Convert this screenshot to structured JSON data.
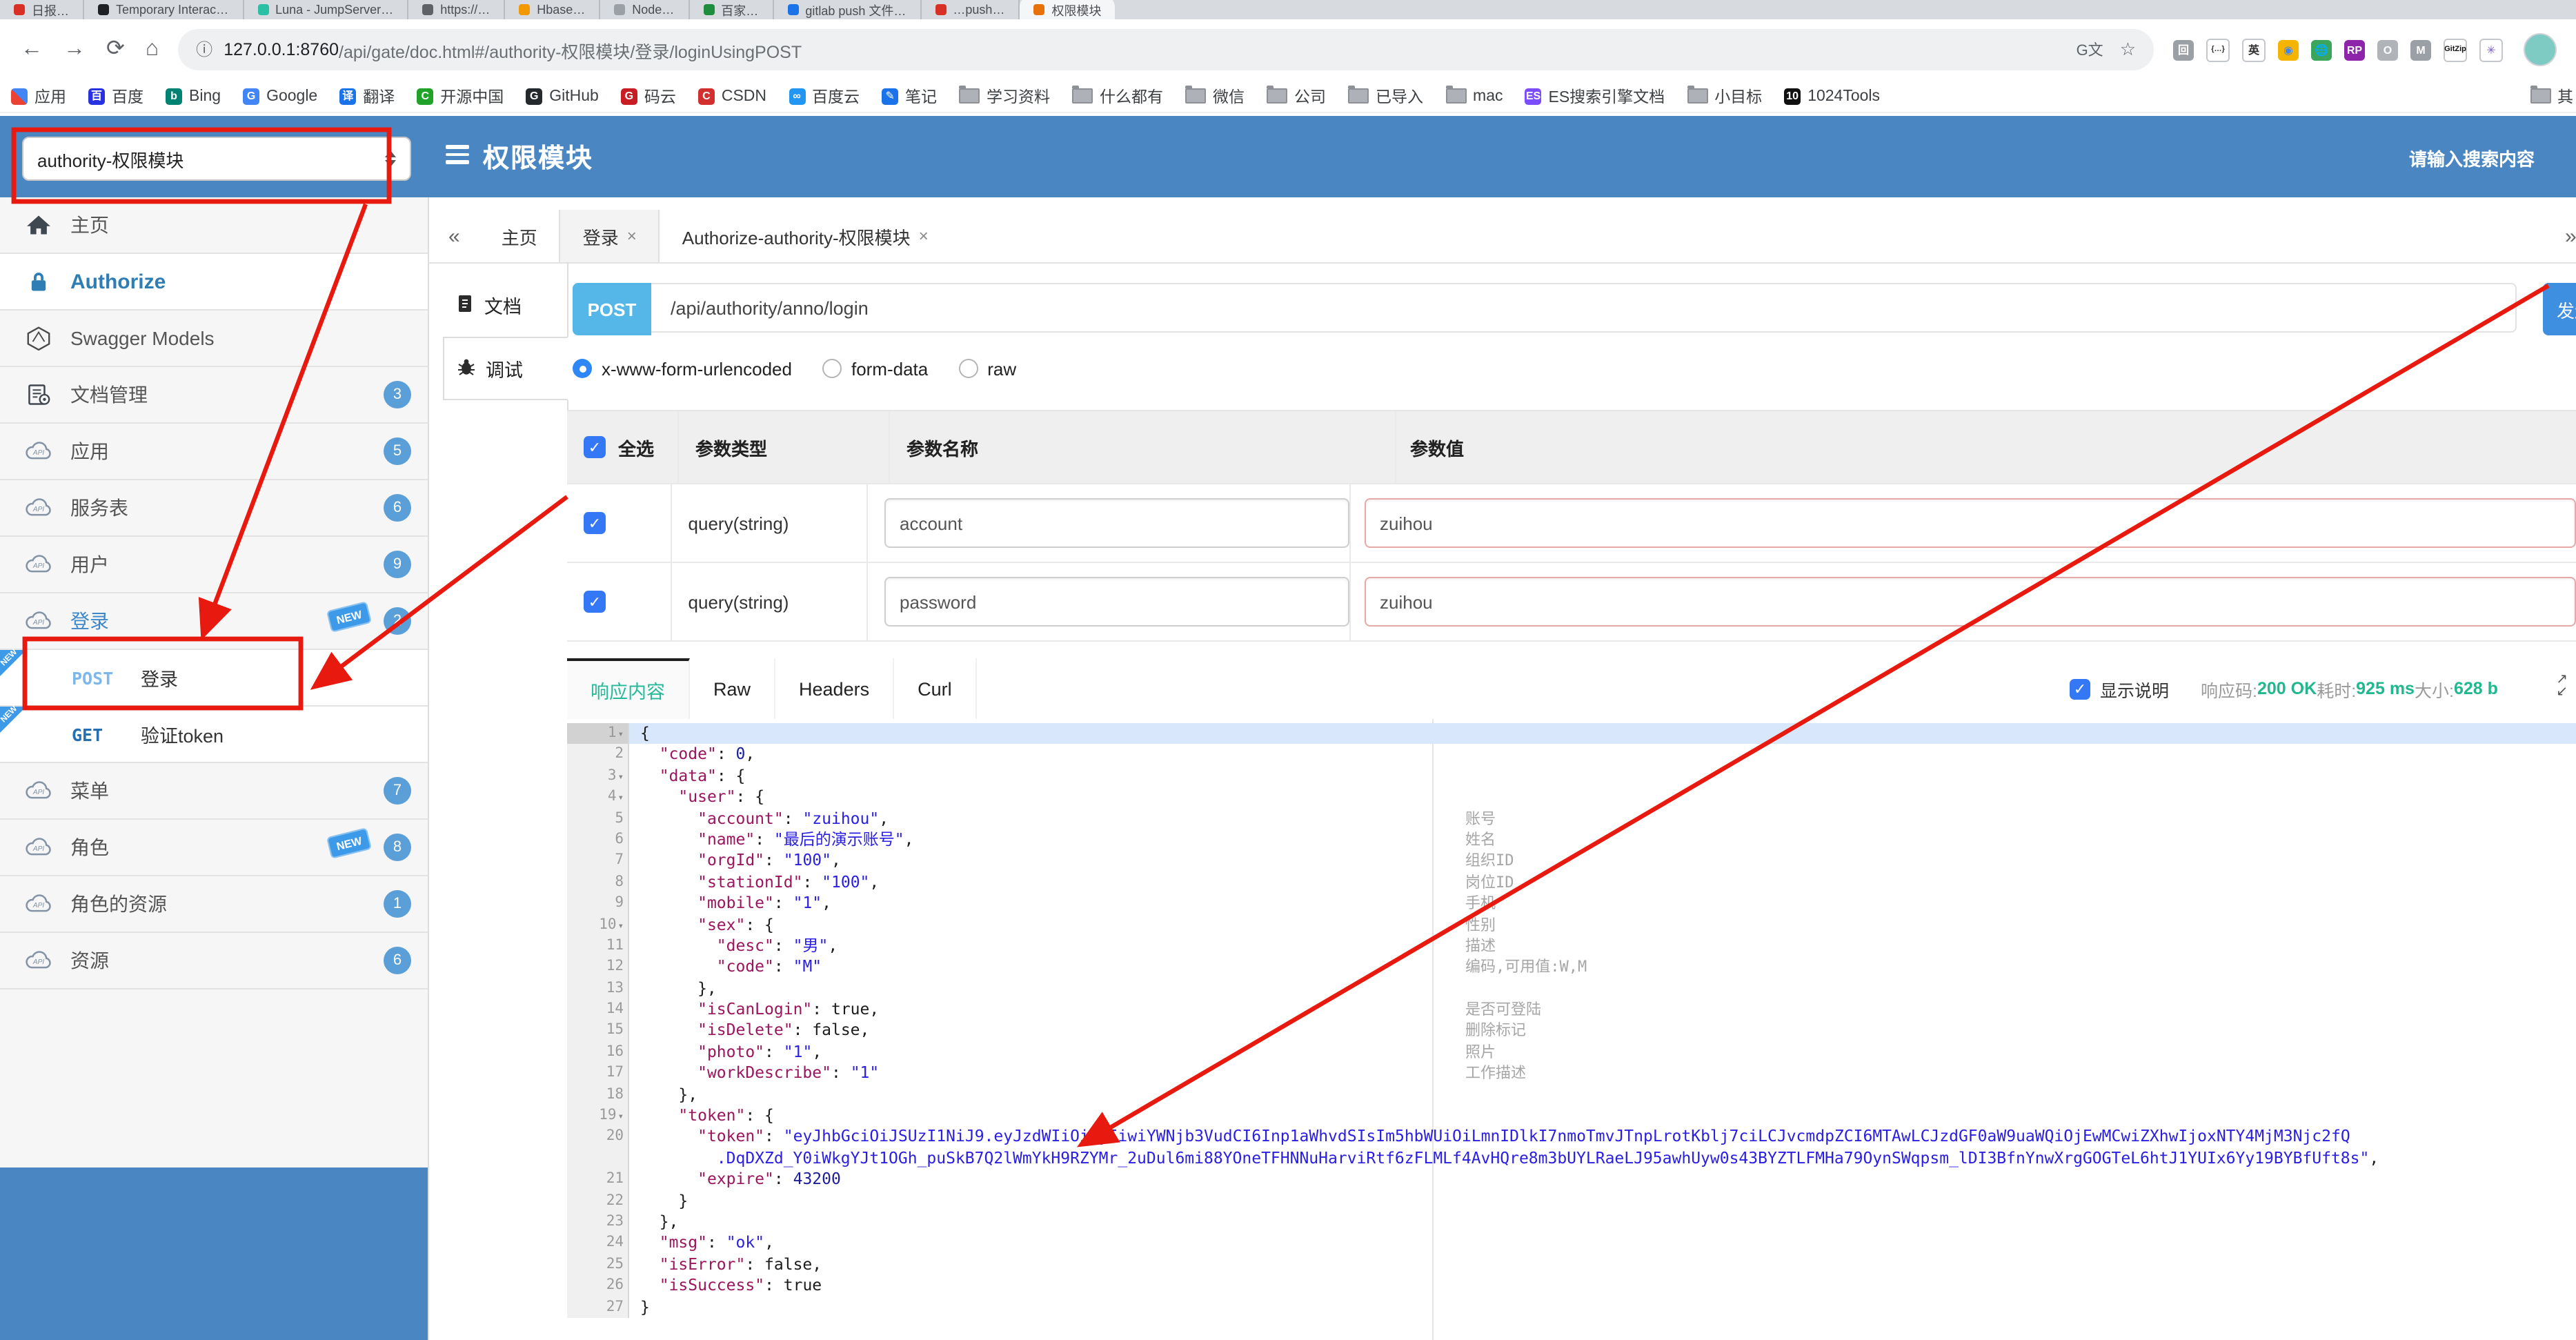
{
  "browser": {
    "tabs": [
      {
        "label": "日报…",
        "color": "#d93025"
      },
      {
        "label": "Temporary Interac…",
        "color": "#202124"
      },
      {
        "label": "Luna - JumpServer…",
        "color": "#2bbfa4"
      },
      {
        "label": "https://…",
        "color": "#5f6368"
      },
      {
        "label": "Hbase…",
        "color": "#f29900"
      },
      {
        "label": "Node…",
        "color": "#9aa0a6"
      },
      {
        "label": "百家…",
        "color": "#1e8e3e"
      },
      {
        "label": "gitlab push 文件…",
        "color": "#1a73e8"
      },
      {
        "label": "…push…",
        "color": "#d93025"
      },
      {
        "label": "权限模块",
        "color": "#e8710a",
        "active": true
      }
    ],
    "toolbar": {
      "url_host": "127.0.0.1:8760",
      "url_path": "/api/gate/doc.html#/authority-权限模块/登录/loginUsingPOST",
      "extensions": [
        {
          "glyph": "回",
          "color": "#9aa0a6"
        },
        {
          "glyph": "{…}",
          "color": "#ffffff",
          "fg": "#333",
          "border": true
        },
        {
          "glyph": "英",
          "color": "#ffffff",
          "fg": "#333",
          "border": true
        },
        {
          "glyph": "◉",
          "color": "#f4b400",
          "fg": "#4285f4"
        },
        {
          "glyph": "🌐",
          "color": "#3ba55c"
        },
        {
          "glyph": "RP",
          "color": "#8e24aa"
        },
        {
          "glyph": "O",
          "color": "#b0b4b9"
        },
        {
          "glyph": "M",
          "color": "#9aa0a6"
        },
        {
          "glyph": "GitZip",
          "color": "#ffffff",
          "fg": "#111",
          "border": true
        },
        {
          "glyph": "✳",
          "color": "#ffffff",
          "fg": "#7b61c4",
          "border": true
        }
      ]
    },
    "bookmarks": [
      {
        "label": "应用",
        "icon": "apps"
      },
      {
        "label": "百度",
        "icon": "sq",
        "color": "#2932e1",
        "glyph": "百"
      },
      {
        "label": "Bing",
        "icon": "sq",
        "color": "#008373",
        "glyph": "b"
      },
      {
        "label": "Google",
        "icon": "sq",
        "color": "#4285f4",
        "glyph": "G"
      },
      {
        "label": "翻译",
        "icon": "sq",
        "color": "#1a73e8",
        "glyph": "译"
      },
      {
        "label": "开源中国",
        "icon": "sq",
        "color": "#21a32a",
        "glyph": "C"
      },
      {
        "label": "GitHub",
        "icon": "sq",
        "color": "#24292e",
        "glyph": "G"
      },
      {
        "label": "码云",
        "icon": "sq",
        "color": "#c71d23",
        "glyph": "G"
      },
      {
        "label": "CSDN",
        "icon": "sq",
        "color": "#d32f2f",
        "glyph": "C"
      },
      {
        "label": "百度云",
        "icon": "sq",
        "color": "#2196f3",
        "glyph": "∞"
      },
      {
        "label": "笔记",
        "icon": "sq",
        "color": "#1a73e8",
        "glyph": "✎"
      },
      {
        "label": "学习资料",
        "icon": "folder"
      },
      {
        "label": "什么都有",
        "icon": "folder"
      },
      {
        "label": "微信",
        "icon": "folder"
      },
      {
        "label": "公司",
        "icon": "folder"
      },
      {
        "label": "已导入",
        "icon": "folder"
      },
      {
        "label": "mac",
        "icon": "folder"
      },
      {
        "label": "ES搜索引擎文档",
        "icon": "sq",
        "color": "#7c4dff",
        "glyph": "ES"
      },
      {
        "label": "小目标",
        "icon": "folder"
      },
      {
        "label": "1024Tools",
        "icon": "sq",
        "color": "#111111",
        "glyph": "10"
      },
      {
        "label": "其",
        "icon": "folder",
        "overflow": true
      }
    ]
  },
  "header": {
    "module_select": "authority-权限模块",
    "title": "权限模块",
    "search_placeholder": "请输入搜索内容"
  },
  "sidebar": {
    "items": [
      {
        "label": "主页",
        "icon": "home"
      },
      {
        "label": "Authorize",
        "icon": "lock",
        "selected": true
      },
      {
        "label": "Swagger Models",
        "icon": "hexagon"
      },
      {
        "label": "文档管理",
        "icon": "docs",
        "badge": "3"
      },
      {
        "label": "应用",
        "icon": "cloud",
        "badge": "5"
      },
      {
        "label": "服务表",
        "icon": "cloud",
        "badge": "6"
      },
      {
        "label": "用户",
        "icon": "cloud",
        "badge": "9"
      },
      {
        "label": "登录",
        "icon": "cloud",
        "badge": "2",
        "new_tag": true,
        "open": true
      },
      {
        "label": "登录",
        "method": "POST",
        "sub": true,
        "new_corner": true
      },
      {
        "label": "验证token",
        "method": "GET",
        "sub": true,
        "new_corner": true
      },
      {
        "label": "菜单",
        "icon": "cloud",
        "badge": "7"
      },
      {
        "label": "角色",
        "icon": "cloud",
        "badge": "8",
        "new_tag": true
      },
      {
        "label": "角色的资源",
        "icon": "cloud",
        "badge": "1"
      },
      {
        "label": "资源",
        "icon": "cloud",
        "badge": "6"
      }
    ]
  },
  "workspace": {
    "collapse_icon": "«",
    "expand_icon": "»",
    "tabs": [
      {
        "label": "主页",
        "closable": false
      },
      {
        "label": "登录",
        "closable": true,
        "active": true
      },
      {
        "label": "Authorize-authority-权限模块",
        "closable": true
      }
    ],
    "side_nav": [
      {
        "label": "文档",
        "icon": "doc"
      },
      {
        "label": "调试",
        "icon": "bug",
        "active": true
      }
    ]
  },
  "request": {
    "method": "POST",
    "url": "/api/authority/anno/login",
    "send_label": "发送",
    "content_types": [
      "x-www-form-urlencoded",
      "form-data",
      "raw"
    ],
    "selected_content_type": "x-www-form-urlencoded",
    "table": {
      "headers": [
        "全选",
        "参数类型",
        "参数名称",
        "参数值"
      ],
      "rows": [
        {
          "checked": true,
          "type": "query(string)",
          "name": "account",
          "value": "zuihou"
        },
        {
          "checked": true,
          "type": "query(string)",
          "name": "password",
          "value": "zuihou"
        }
      ]
    }
  },
  "response": {
    "tabs": [
      "响应内容",
      "Raw",
      "Headers",
      "Curl"
    ],
    "active_tab": "响应内容",
    "show_desc": {
      "checked": true,
      "label": "显示说明"
    },
    "meta": [
      {
        "label": "响应码:",
        "value": "200 OK"
      },
      {
        "label": "耗时:",
        "value": "925 ms"
      },
      {
        "label": "大小:",
        "value": "628 b"
      }
    ],
    "code": {
      "lines": [
        {
          "n": 1,
          "fold": true,
          "sel": true,
          "seg": [
            [
              "p",
              "{"
            ]
          ]
        },
        {
          "n": 2,
          "seg": [
            [
              "p",
              "  "
            ],
            [
              "k",
              "\"code\""
            ],
            [
              "p",
              ": "
            ],
            [
              "n",
              "0"
            ],
            [
              "p",
              ","
            ]
          ]
        },
        {
          "n": 3,
          "fold": true,
          "seg": [
            [
              "p",
              "  "
            ],
            [
              "k",
              "\"data\""
            ],
            [
              "p",
              ": {"
            ]
          ]
        },
        {
          "n": 4,
          "fold": true,
          "seg": [
            [
              "p",
              "    "
            ],
            [
              "k",
              "\"user\""
            ],
            [
              "p",
              ": {"
            ]
          ]
        },
        {
          "n": 5,
          "cm": "账号",
          "seg": [
            [
              "p",
              "      "
            ],
            [
              "k",
              "\"account\""
            ],
            [
              "p",
              ": "
            ],
            [
              "s",
              "\"zuihou\""
            ],
            [
              "p",
              ","
            ]
          ]
        },
        {
          "n": 6,
          "cm": "姓名",
          "seg": [
            [
              "p",
              "      "
            ],
            [
              "k",
              "\"name\""
            ],
            [
              "p",
              ": "
            ],
            [
              "s",
              "\"最后的演示账号\""
            ],
            [
              "p",
              ","
            ]
          ]
        },
        {
          "n": 7,
          "cm": "组织ID",
          "seg": [
            [
              "p",
              "      "
            ],
            [
              "k",
              "\"orgId\""
            ],
            [
              "p",
              ": "
            ],
            [
              "s",
              "\"100\""
            ],
            [
              "p",
              ","
            ]
          ]
        },
        {
          "n": 8,
          "cm": "岗位ID",
          "seg": [
            [
              "p",
              "      "
            ],
            [
              "k",
              "\"stationId\""
            ],
            [
              "p",
              ": "
            ],
            [
              "s",
              "\"100\""
            ],
            [
              "p",
              ","
            ]
          ]
        },
        {
          "n": 9,
          "cm": "手机",
          "seg": [
            [
              "p",
              "      "
            ],
            [
              "k",
              "\"mobile\""
            ],
            [
              "p",
              ": "
            ],
            [
              "s",
              "\"1\""
            ],
            [
              "p",
              ","
            ]
          ]
        },
        {
          "n": 10,
          "fold": true,
          "cm": "性别",
          "seg": [
            [
              "p",
              "      "
            ],
            [
              "k",
              "\"sex\""
            ],
            [
              "p",
              ": {"
            ]
          ]
        },
        {
          "n": 11,
          "cm": "描述",
          "seg": [
            [
              "p",
              "        "
            ],
            [
              "k",
              "\"desc\""
            ],
            [
              "p",
              ": "
            ],
            [
              "s",
              "\"男\""
            ],
            [
              "p",
              ","
            ]
          ]
        },
        {
          "n": 12,
          "cm": "编码,可用值:W,M",
          "seg": [
            [
              "p",
              "        "
            ],
            [
              "k",
              "\"code\""
            ],
            [
              "p",
              ": "
            ],
            [
              "s",
              "\"M\""
            ]
          ]
        },
        {
          "n": 13,
          "seg": [
            [
              "p",
              "      },"
            ]
          ]
        },
        {
          "n": 14,
          "cm": "是否可登陆",
          "seg": [
            [
              "p",
              "      "
            ],
            [
              "k",
              "\"isCanLogin\""
            ],
            [
              "p",
              ": true,"
            ]
          ]
        },
        {
          "n": 15,
          "cm": "删除标记",
          "seg": [
            [
              "p",
              "      "
            ],
            [
              "k",
              "\"isDelete\""
            ],
            [
              "p",
              ": false,"
            ]
          ]
        },
        {
          "n": 16,
          "cm": "照片",
          "seg": [
            [
              "p",
              "      "
            ],
            [
              "k",
              "\"photo\""
            ],
            [
              "p",
              ": "
            ],
            [
              "s",
              "\"1\""
            ],
            [
              "p",
              ","
            ]
          ]
        },
        {
          "n": 17,
          "cm": "工作描述",
          "seg": [
            [
              "p",
              "      "
            ],
            [
              "k",
              "\"workDescribe\""
            ],
            [
              "p",
              ": "
            ],
            [
              "s",
              "\"1\""
            ]
          ]
        },
        {
          "n": 18,
          "seg": [
            [
              "p",
              "    },"
            ]
          ]
        },
        {
          "n": 19,
          "fold": true,
          "seg": [
            [
              "p",
              "    "
            ],
            [
              "k",
              "\"token\""
            ],
            [
              "p",
              ": {"
            ]
          ]
        },
        {
          "n": 20,
          "seg": [
            [
              "p",
              "      "
            ],
            [
              "k",
              "\"token\""
            ],
            [
              "p",
              ": "
            ],
            [
              "s",
              "\"eyJhbGciOiJSUzI1NiJ9.eyJzdWIiOiIyIiwiYWNjb3VudCI6Inp1aWhvdSIsIm5hbWUiOiLmnIDlkI7nmoTmvJTnpLrotKblj7ciLCJvcmdpZCI6MTAwLCJzdGF0aW9uaWQiOjEwMCwiZXhwIjoxNTY4MjM3Njc2fQ"
            ]
          ]
        },
        {
          "n": null,
          "seg": [
            [
              "p",
              "        "
            ],
            [
              "s",
              ".DqDXZd_Y0iWkgYJt1OGh_puSkB7Q2lWmYkH9RZYMr_2uDul6mi88YOneTFHNNuHarviRtf6zFLMLf4AvHQre8m3bUYLRaeLJ95awhUyw0s43BYZTLFMHa79OynSWqpsm_lDI3BfnYnwXrgGOGTeL6htJ1YUIx6Yy19BYBfUft8s\""
            ],
            [
              "p",
              ","
            ]
          ]
        },
        {
          "n": 21,
          "seg": [
            [
              "p",
              "      "
            ],
            [
              "k",
              "\"expire\""
            ],
            [
              "p",
              ": "
            ],
            [
              "n",
              "43200"
            ]
          ]
        },
        {
          "n": 22,
          "seg": [
            [
              "p",
              "    }"
            ]
          ]
        },
        {
          "n": 23,
          "seg": [
            [
              "p",
              "  },"
            ]
          ]
        },
        {
          "n": 24,
          "seg": [
            [
              "p",
              "  "
            ],
            [
              "k",
              "\"msg\""
            ],
            [
              "p",
              ": "
            ],
            [
              "s",
              "\"ok\""
            ],
            [
              "p",
              ","
            ]
          ]
        },
        {
          "n": 25,
          "seg": [
            [
              "p",
              "  "
            ],
            [
              "k",
              "\"isError\""
            ],
            [
              "p",
              ": false,"
            ]
          ]
        },
        {
          "n": 26,
          "seg": [
            [
              "p",
              "  "
            ],
            [
              "k",
              "\"isSuccess\""
            ],
            [
              "p",
              ": true"
            ]
          ]
        },
        {
          "n": 27,
          "seg": [
            [
              "p",
              "}"
            ]
          ]
        }
      ]
    }
  },
  "colors": {
    "blue_header": "#4a87c2",
    "badge": "#5b9fd8",
    "new_tag": "#3d9ae8",
    "post_pill": "#54b7e7",
    "green": "#21b88f",
    "annotation_red": "#e8190e",
    "code_key": "#9b155c",
    "code_string": "#2a1fe0",
    "code_number": "#1d1d9c"
  }
}
